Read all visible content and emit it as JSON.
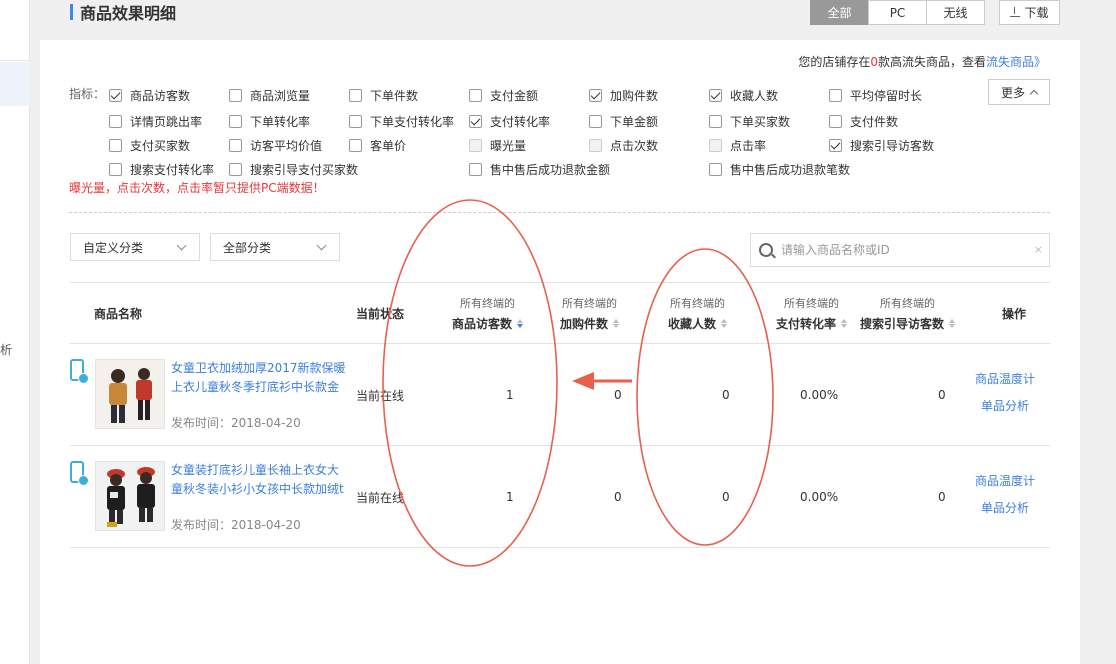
{
  "header": {
    "title": "商品效果明细",
    "segments": [
      {
        "label": "全部",
        "active": true
      },
      {
        "label": "PC",
        "active": false
      },
      {
        "label": "无线",
        "active": false
      }
    ],
    "download_label": "下载"
  },
  "notice": {
    "prefix": "您的店铺存在",
    "count": "0",
    "suffix": "款高流失商品，查看",
    "link": "流失商品》"
  },
  "indicators": {
    "label": "指标：",
    "more_label": "更多",
    "items": [
      {
        "label": "商品访客数",
        "checked": true,
        "disabled": false
      },
      {
        "label": "商品浏览量",
        "checked": false,
        "disabled": false
      },
      {
        "label": "下单件数",
        "checked": false,
        "disabled": false
      },
      {
        "label": "支付金额",
        "checked": false,
        "disabled": false
      },
      {
        "label": "加购件数",
        "checked": true,
        "disabled": false
      },
      {
        "label": "收藏人数",
        "checked": true,
        "disabled": false
      },
      {
        "label": "平均停留时长",
        "checked": false,
        "disabled": false
      },
      {
        "label": "详情页跳出率",
        "checked": false,
        "disabled": false
      },
      {
        "label": "下单转化率",
        "checked": false,
        "disabled": false
      },
      {
        "label": "下单支付转化率",
        "checked": false,
        "disabled": false
      },
      {
        "label": "支付转化率",
        "checked": true,
        "disabled": false
      },
      {
        "label": "下单金额",
        "checked": false,
        "disabled": false
      },
      {
        "label": "下单买家数",
        "checked": false,
        "disabled": false
      },
      {
        "label": "支付件数",
        "checked": false,
        "disabled": false
      },
      {
        "label": "支付买家数",
        "checked": false,
        "disabled": false
      },
      {
        "label": "访客平均价值",
        "checked": false,
        "disabled": false
      },
      {
        "label": "客单价",
        "checked": false,
        "disabled": false
      },
      {
        "label": "曝光量",
        "checked": false,
        "disabled": true
      },
      {
        "label": "点击次数",
        "checked": false,
        "disabled": true
      },
      {
        "label": "点击率",
        "checked": false,
        "disabled": true
      },
      {
        "label": "搜索引导访客数",
        "checked": true,
        "disabled": false
      },
      {
        "label": "搜索支付转化率",
        "checked": false,
        "disabled": false
      },
      {
        "label": "搜索引导支付买家数",
        "checked": false,
        "disabled": false
      },
      {
        "label": "售中售后成功退款金额",
        "checked": false,
        "disabled": false
      },
      {
        "label": "售中售后成功退款笔数",
        "checked": false,
        "disabled": false
      }
    ],
    "warning": "曝光量，点击次数，点击率暂只提供PC端数据！"
  },
  "filters": {
    "custom_category": "自定义分类",
    "all_category": "全部分类",
    "search_placeholder": "请输入商品名称或ID",
    "clear_symbol": "×"
  },
  "table": {
    "columns": {
      "name": "商品名称",
      "status": "当前状态",
      "visitors_sub": "所有终端的",
      "visitors": "商品访客数",
      "cart_sub": "所有终端的",
      "cart": "加购件数",
      "fav_sub": "所有终端的",
      "fav": "收藏人数",
      "pay_sub": "所有终端的",
      "pay": "支付转化率",
      "search_sub": "所有终端的",
      "search": "搜索引导访客数",
      "ops": "操作"
    },
    "rows": [
      {
        "title": "女童卫衣加绒加厚2017新款保暖上衣儿童秋冬季打底衫中长款金",
        "published": "发布时间：2018-04-20",
        "status": "当前在线",
        "visitors": "1",
        "cart": "0",
        "fav": "0",
        "pay_rate": "0.00%",
        "search_visitors": "0",
        "op1": "商品温度计",
        "op2": "单品分析"
      },
      {
        "title": "女童装打底衫儿童长袖上衣女大童秋冬装小衫小女孩中长款加绒t",
        "published": "发布时间：2018-04-20",
        "status": "当前在线",
        "visitors": "1",
        "cart": "0",
        "fav": "0",
        "pay_rate": "0.00%",
        "search_visitors": "0",
        "op1": "商品温度计",
        "op2": "单品分析"
      }
    ]
  },
  "sidebar": {
    "glyph": "析"
  },
  "colors": {
    "accent": "#3c7ee0",
    "title_bar": "#3c8ce7",
    "warning": "#e4393c",
    "annotation": "#e8604c"
  }
}
